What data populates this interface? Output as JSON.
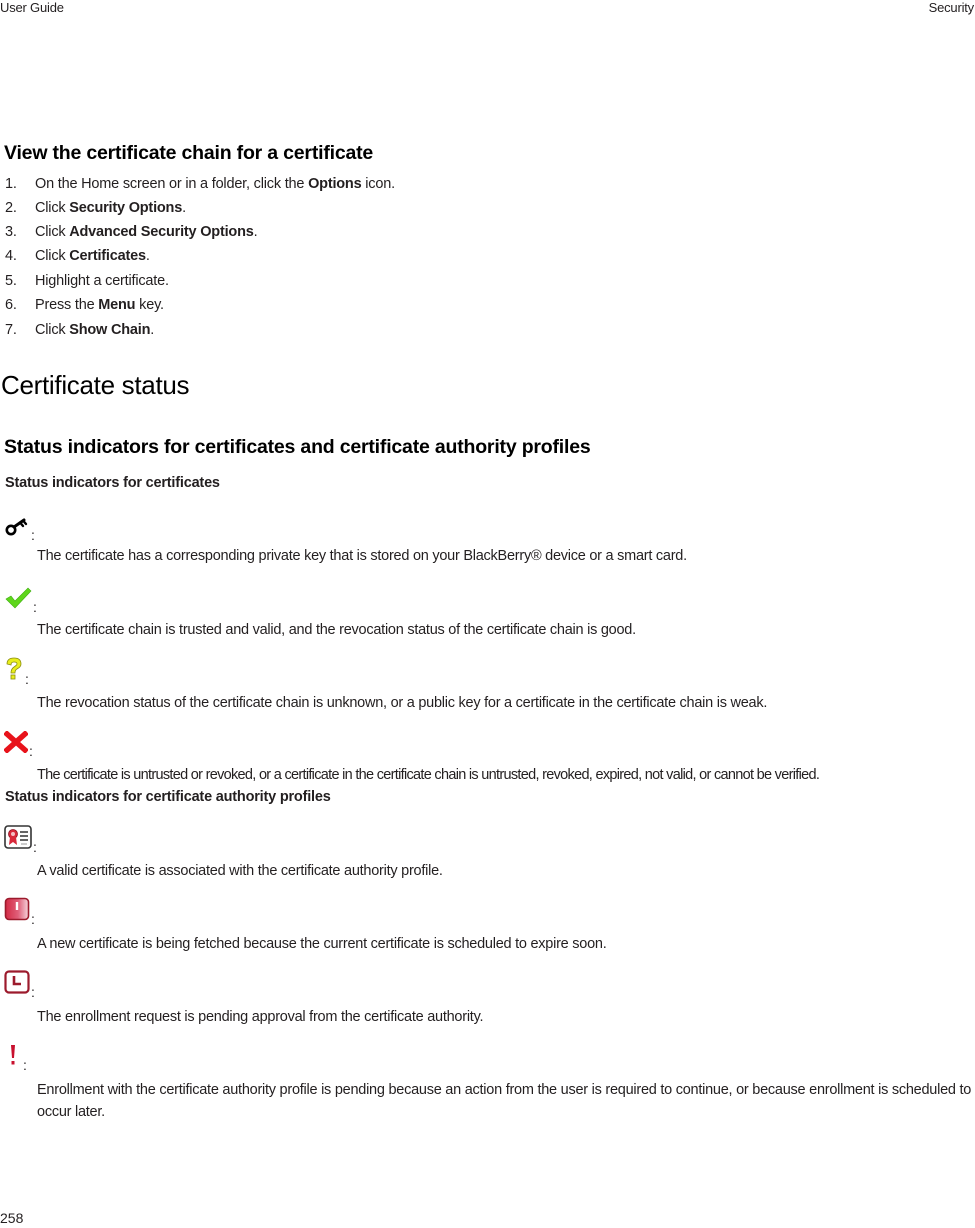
{
  "header": {
    "left": "User Guide",
    "right": "Security"
  },
  "section1": {
    "title": "View the certificate chain for a certificate",
    "steps": [
      {
        "num": "1.",
        "pre": "On the Home screen or in a folder, click the ",
        "bold": "Options",
        "post": " icon."
      },
      {
        "num": "2.",
        "pre": "Click ",
        "bold": "Security Options",
        "post": "."
      },
      {
        "num": "3.",
        "pre": "Click ",
        "bold": "Advanced Security Options",
        "post": "."
      },
      {
        "num": "4.",
        "pre": "Click ",
        "bold": "Certificates",
        "post": "."
      },
      {
        "num": "5.",
        "pre": "Highlight a certificate.",
        "bold": "",
        "post": ""
      },
      {
        "num": "6.",
        "pre": "Press the ",
        "bold": "Menu",
        "post": " key."
      },
      {
        "num": "7.",
        "pre": "Click ",
        "bold": "Show Chain",
        "post": "."
      }
    ]
  },
  "section2": {
    "title": "Certificate status",
    "subtitle": "Status indicators for certificates and certificate authority profiles",
    "cert_group": {
      "title": "Status indicators for certificates",
      "items": [
        {
          "icon": "key-icon",
          "colon": ":",
          "text": "The certificate has a corresponding private key that is stored on your BlackBerry® device or a smart card."
        },
        {
          "icon": "checkmark-icon",
          "colon": ":",
          "text": "The certificate chain is trusted and valid, and the revocation status of the certificate chain is good."
        },
        {
          "icon": "question-mark-icon",
          "colon": ":",
          "text": "The revocation status of the certificate chain is unknown, or a public key for a certificate in the certificate chain is weak."
        },
        {
          "icon": "red-x-icon",
          "colon": ":",
          "text": "The certificate is untrusted or revoked, or a certificate in the certificate chain is untrusted, revoked, expired, not valid, or cannot be verified."
        }
      ]
    },
    "ca_group": {
      "title": "Status indicators for certificate authority profiles",
      "items": [
        {
          "icon": "valid-certificate-icon",
          "colon": ":",
          "text": "A valid certificate is associated with the certificate authority profile."
        },
        {
          "icon": "expiring-certificate-icon",
          "colon": ":",
          "text": "A new certificate is being fetched because the current certificate is scheduled to expire soon."
        },
        {
          "icon": "pending-clock-icon",
          "colon": ":",
          "text": "The enrollment request is pending approval from the certificate authority."
        },
        {
          "icon": "exclamation-icon",
          "colon": ":",
          "text": "Enrollment with the certificate authority profile is pending because an action from the user is required to continue, or because enrollment is scheduled to occur later."
        }
      ]
    }
  },
  "footer": {
    "page_number": "258"
  },
  "colors": {
    "text": "#231f20",
    "check_green": "#5ed61b",
    "question_yellow": "#e8ee1a",
    "x_red": "#e8131b",
    "ca_red": "#b0182a"
  }
}
